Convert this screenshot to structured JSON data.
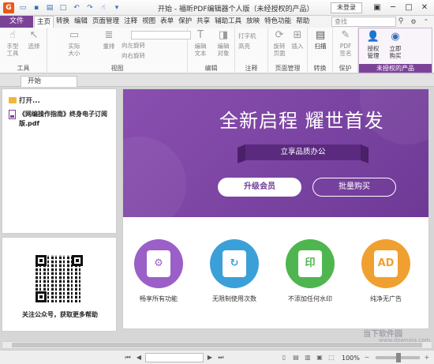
{
  "titlebar": {
    "title": "开始 - 福昕PDF编辑器个人版（未经授权的产品）",
    "login": "未登录",
    "app_icon": "G",
    "qat_icons": [
      "open-folder-icon",
      "save-icon",
      "print-icon",
      "new-doc-icon",
      "undo-icon",
      "redo-icon",
      "hand-tool-icon",
      "dropdown-icon"
    ]
  },
  "menu": {
    "file": "文件",
    "tabs": [
      "主页",
      "转换",
      "编辑",
      "页面管理",
      "注释",
      "视图",
      "表单",
      "保护",
      "共享",
      "辅助工具",
      "放映",
      "特色功能",
      "帮助"
    ],
    "active_tab": "主页",
    "search_placeholder": "查找"
  },
  "ribbon": {
    "tools_group": "工具",
    "hand_tool": "手型\n工具",
    "select": "选择",
    "view_group": "视图",
    "actual_size": "实际\n大小",
    "reflow": "重排",
    "rotate_left": "向左旋转",
    "rotate_right": "向右旋转",
    "edit_group": "编辑",
    "edit_text": "编辑\n文本",
    "edit_object": "编辑\n对象",
    "comment_group": "注释",
    "typewriter": "打字机",
    "highlight": "高亮",
    "page_group": "页面管理",
    "rotate_page": "旋转\n页面",
    "insert": "插入",
    "convert_group": "转换",
    "scan": "扫描",
    "protect_group": "保护",
    "pdf_sign": "PDF\n签名",
    "license_group": "未授权的产品",
    "authorize": "授权\n管理",
    "buy_now": "立即\n购买"
  },
  "doc_tab": "开始",
  "left_panel": {
    "open_label": "打开...",
    "recent_file": "《网编操作指南》终身电子订阅版.pdf",
    "qr_caption": "关注公众号，获取更多帮助"
  },
  "banner": {
    "title": "全新启程 耀世首发",
    "tagline": "立享品质办公",
    "upgrade_button": "升级会员",
    "bulk_button": "批量购买"
  },
  "features": [
    {
      "label": "畅享所有功能",
      "color": "#9b5fc8",
      "glyph": "⚙",
      "icon": "gear-icon"
    },
    {
      "label": "无限制使用次数",
      "color": "#3ba0d8",
      "glyph": "↻",
      "icon": "refresh-icon"
    },
    {
      "label": "不添加任何水印",
      "color": "#4fb54f",
      "glyph": "印",
      "icon": "stamp-icon"
    },
    {
      "label": "纯净无广告",
      "color": "#f0a030",
      "glyph": "AD",
      "icon": "ad-icon"
    }
  ],
  "status": {
    "zoom": "100%"
  },
  "watermark": {
    "text": "当下软件园",
    "url": "www.downxia.com"
  },
  "colors": {
    "brand_purple": "#7b4397",
    "banner_purple": "#8a4fb0"
  }
}
